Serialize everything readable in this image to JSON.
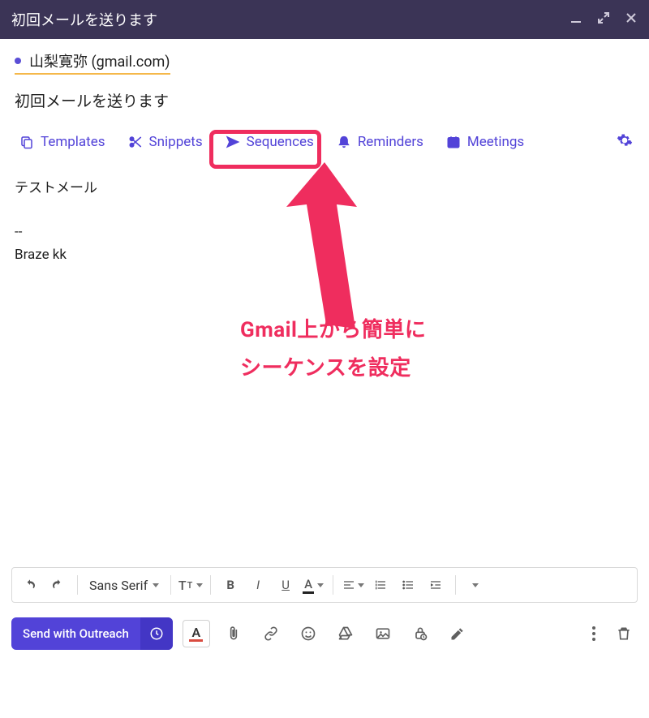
{
  "window": {
    "title": "初回メールを送ります"
  },
  "recipient": {
    "name": "山梨寛弥 (gmail.com)"
  },
  "subject": "初回メールを送ります",
  "plugin_toolbar": {
    "templates": "Templates",
    "snippets": "Snippets",
    "sequences": "Sequences",
    "reminders": "Reminders",
    "meetings": "Meetings"
  },
  "body": {
    "line1": "テストメール",
    "sig_sep": "--",
    "signature": "Braze kk"
  },
  "annotation": {
    "line1": "Gmail上から簡単に",
    "line2": "シーケンスを設定"
  },
  "format_toolbar": {
    "font_family": "Sans Serif",
    "font_size_glyph_large": "T",
    "font_size_glyph_small": "T",
    "bold": "B",
    "italic": "I",
    "underline": "U",
    "text_color": "A"
  },
  "send": {
    "label": "Send with Outreach"
  },
  "colors": {
    "accent": "#5243d8",
    "highlight": "#ef2d5e",
    "titlebar": "#3b3456",
    "chip_underline": "#f5b84a"
  }
}
